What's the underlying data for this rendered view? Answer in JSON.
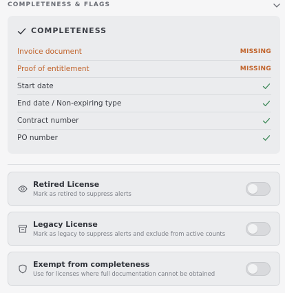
{
  "section": {
    "title": "COMPLETENESS & FLAGS",
    "chevron_icon": "chevron-down-icon"
  },
  "completeness": {
    "title": "COMPLETENESS",
    "rows": [
      {
        "label": "Invoice document",
        "status": "MISSING"
      },
      {
        "label": "Proof of entitlement",
        "status": "MISSING"
      },
      {
        "label": "Start date",
        "status": "complete"
      },
      {
        "label": "End date / Non-expiring type",
        "status": "complete"
      },
      {
        "label": "Contract number",
        "status": "complete"
      },
      {
        "label": "PO number",
        "status": "complete"
      }
    ]
  },
  "flags": [
    {
      "title": "Retired License",
      "description": "Mark as retired to suppress alerts",
      "icon": "eye-icon",
      "enabled": false
    },
    {
      "title": "Legacy License",
      "description": "Mark as legacy to suppress alerts and exclude from active counts",
      "icon": "archive-icon",
      "enabled": false
    },
    {
      "title": "Exempt from completeness",
      "description": "Use for licenses where full documentation cannot be obtained",
      "icon": "shield-icon",
      "enabled": false
    }
  ],
  "colors": {
    "missing": "#c1632b",
    "check": "#3f8a5a",
    "card_bg": "#ebecee"
  }
}
